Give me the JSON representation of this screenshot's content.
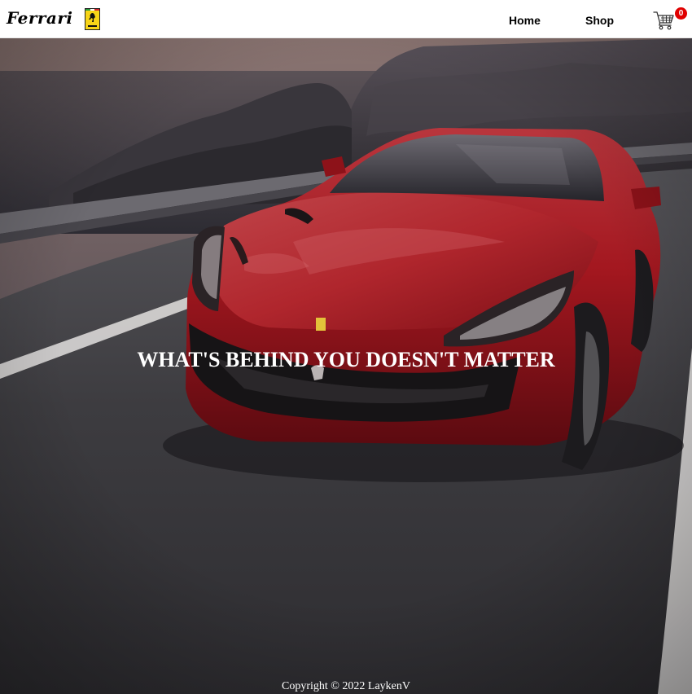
{
  "header": {
    "brand_wordmark": "Ferrari",
    "nav": {
      "home_label": "Home",
      "shop_label": "Shop"
    },
    "cart": {
      "count": "0"
    }
  },
  "hero": {
    "tagline": "WHAT'S BEHIND YOU DOESN'T MATTER",
    "image": "red-ferrari-coastal-road"
  },
  "footer": {
    "copyright": "Copyright © 2022 LaykenV"
  },
  "colors": {
    "header_bg": "#ffffff",
    "nav_text": "#000000",
    "cart_badge": "#e00000",
    "hero_text": "#ffffff",
    "car_red": "#a2161e",
    "road": "#3a3a3d",
    "shield_yellow": "#f7d417"
  }
}
